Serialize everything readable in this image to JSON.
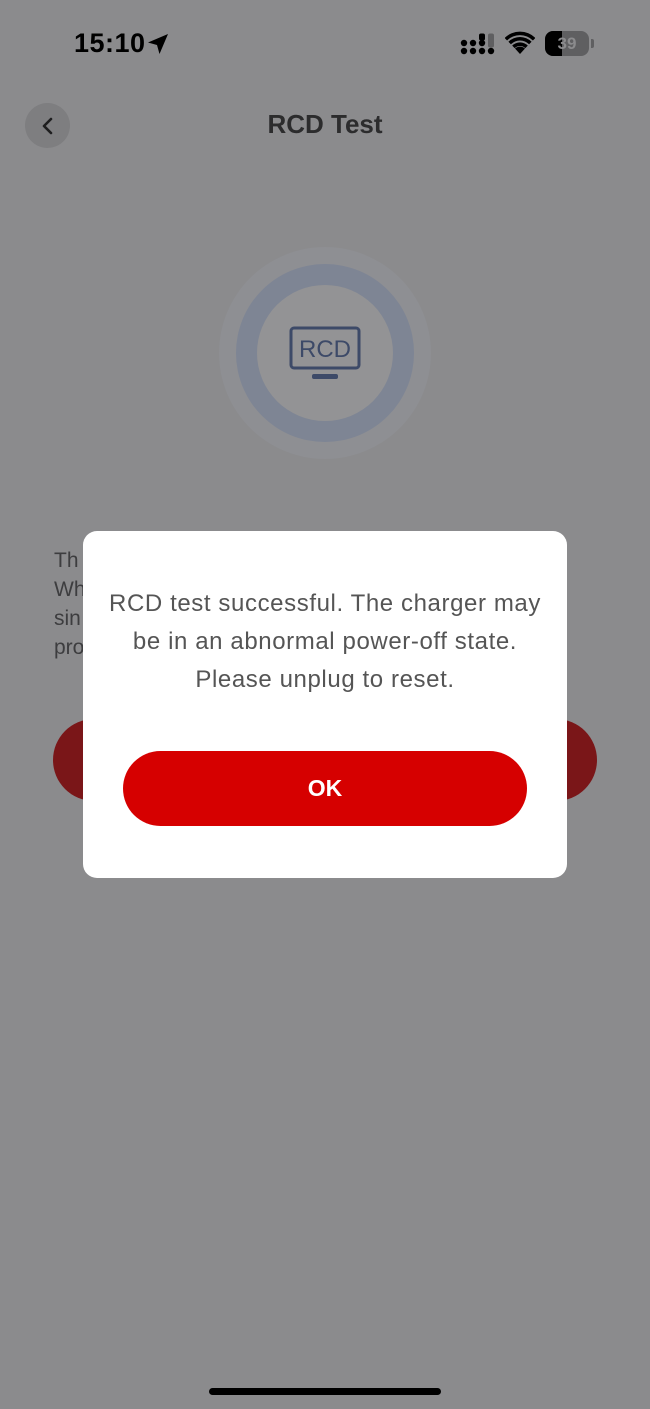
{
  "status_bar": {
    "time": "15:10",
    "battery_level": "39",
    "battery_fraction": 0.39,
    "icons": [
      "location-arrow-icon",
      "cellular-signal-icon",
      "wifi-icon",
      "battery-icon"
    ]
  },
  "header": {
    "title": "RCD Test",
    "back_icon": "chevron-left-icon"
  },
  "illustration": {
    "label": "RCD",
    "icon": "rcd-monitor-icon"
  },
  "background": {
    "description_fragments": [
      "Th",
      "Wh",
      "sin",
      "pro"
    ]
  },
  "dialog": {
    "message": "RCD test successful. The charger may be in an abnormal power-off state. Please unplug to reset.",
    "ok_label": "OK"
  },
  "colors": {
    "accent": "#d60000",
    "overlay_background": "#8b8b8d",
    "dialog_background": "#ffffff"
  }
}
